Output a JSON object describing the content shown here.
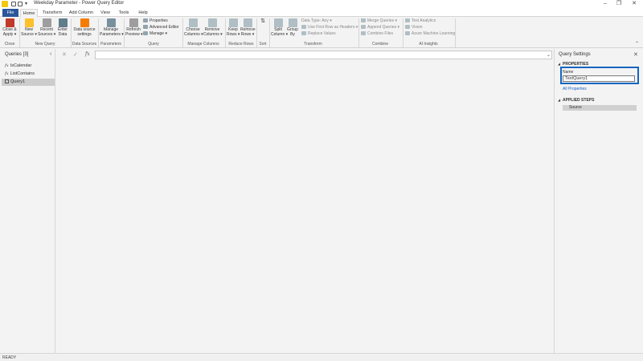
{
  "window": {
    "title": "Weekday Parameter - Power Query Editor",
    "controls": [
      "–",
      "❐",
      "✕"
    ]
  },
  "tabs": [
    {
      "label": "File"
    },
    {
      "label": "Home"
    },
    {
      "label": "Transform"
    },
    {
      "label": "Add Column"
    },
    {
      "label": "View"
    },
    {
      "label": "Tools"
    },
    {
      "label": "Help"
    }
  ],
  "ribbon": {
    "close_apply": "Close &\nApply ▾",
    "new_source": "New\nSource ▾",
    "recent_sources": "Recent\nSources ▾",
    "enter_data": "Enter\nData",
    "data_source_settings": "Data source\nsettings",
    "manage_parameters": "Manage\nParameters ▾",
    "refresh_preview": "Refresh\nPreview ▾",
    "properties": "Properties",
    "advanced_editor": "Advanced Editor",
    "manage": "Manage ▾",
    "choose_columns": "Choose\nColumns ▾",
    "remove_columns": "Remove\nColumns ▾",
    "keep_rows": "Keep\nRows ▾",
    "remove_rows": "Remove\nRows ▾",
    "split_column": "Split\nColumn ▾",
    "group_by": "Group\nBy",
    "data_type": "Data Type: Any ▾",
    "use_first_row": "Use First Row as Headers ▾",
    "replace_values": "Replace Values",
    "merge_queries": "Merge Queries ▾",
    "append_queries": "Append Queries ▾",
    "combine_files": "Combine Files",
    "text_analytics": "Text Analytics",
    "vision": "Vision",
    "azure_ml": "Azure Machine Learning",
    "groups": {
      "close": "Close",
      "new_query": "New Query",
      "data_sources": "Data Sources",
      "parameters": "Parameters",
      "query": "Query",
      "manage_columns": "Manage Columns",
      "reduce_rows": "Reduce Rows",
      "sort": "Sort",
      "transform": "Transform",
      "combine": "Combine",
      "ai_insights": "AI Insights"
    }
  },
  "queries_panel": {
    "header": "Queries [3]",
    "collapse": "‹",
    "items": [
      {
        "label": "IsCalendar",
        "fx": "fx"
      },
      {
        "label": "ListContains",
        "fx": "fx"
      },
      {
        "label": "Query1"
      }
    ]
  },
  "formula_bar": {
    "cancel": "✕",
    "commit": "✓",
    "fx": "fx",
    "expand": "⌄",
    "value": ""
  },
  "query_settings": {
    "title": "Query Settings",
    "close": "✕",
    "properties_header": "PROPERTIES",
    "name_label": "Name",
    "name_value": "TextQuery1",
    "all_properties": "All Properties",
    "applied_steps_header": "APPLIED STEPS",
    "steps": [
      "Source"
    ]
  },
  "status_bar": {
    "text": "READY"
  },
  "colors": {
    "accent": "#2b579a",
    "highlight_box": "#1565c0",
    "logo": "#f2c811"
  }
}
